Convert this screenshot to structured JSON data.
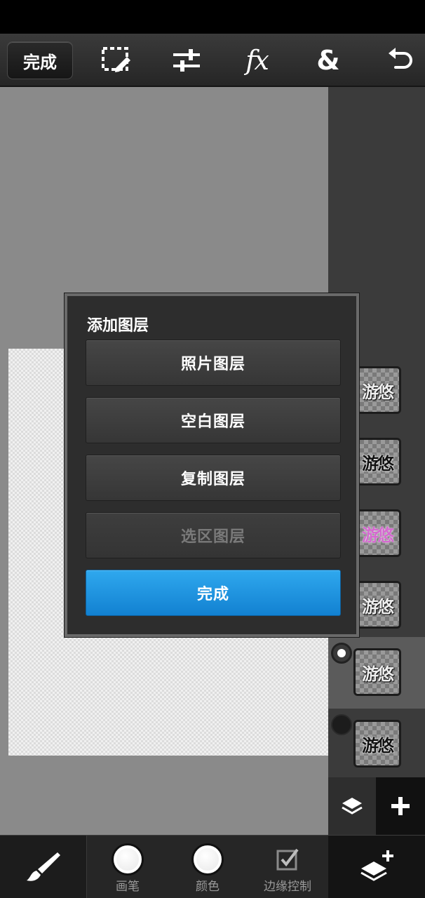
{
  "toolbar": {
    "done_label": "完成",
    "icons": [
      "select-edit-icon",
      "adjust-sliders-icon",
      "fx-icon",
      "blend-ampersand-icon",
      "undo-icon"
    ],
    "fx_label": "fx",
    "amp_label": "&"
  },
  "dialog": {
    "title": "添加图层",
    "photo_layer": "照片图层",
    "blank_layer": "空白图层",
    "duplicate_layer": "复制图层",
    "selection_layer": "选区图层",
    "done": "完成"
  },
  "layers": {
    "items": [
      {
        "thumb_text": "游悠",
        "style": "white"
      },
      {
        "thumb_text": "游悠",
        "style": "dark"
      },
      {
        "thumb_text": "游悠",
        "style": "pink"
      },
      {
        "thumb_text": "游悠",
        "style": "white"
      },
      {
        "thumb_text": "游悠",
        "style": "white",
        "selected": true
      },
      {
        "thumb_text": "游悠",
        "style": "dark"
      }
    ]
  },
  "bottom": {
    "brush_label": "画笔",
    "color_label": "颜色",
    "edge_label": "边缘控制"
  },
  "colors": {
    "accent": "#1a8fdc",
    "canvas_bg": "#8a8a8a",
    "panel_bg": "#3b3b3b"
  }
}
